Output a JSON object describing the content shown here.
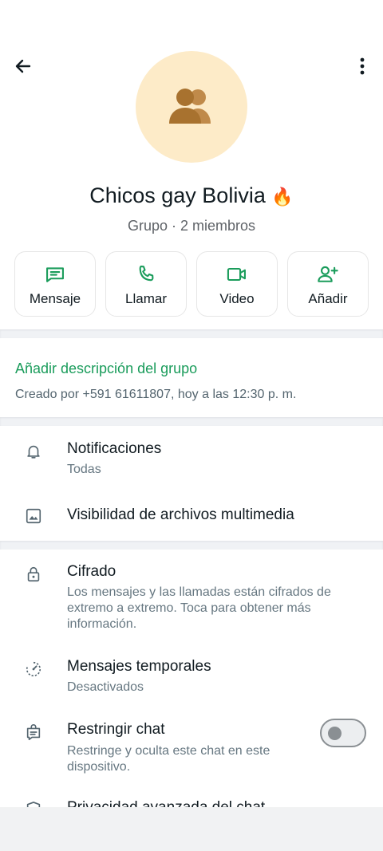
{
  "header": {
    "back_icon": "arrow-left-icon",
    "menu_icon": "more-vertical-icon"
  },
  "group": {
    "avatar_icon": "group-people-icon",
    "name": "Chicos gay Bolivia",
    "emoji": "🔥",
    "meta": "Grupo · 2 miembros"
  },
  "actions": [
    {
      "label": "Mensaje",
      "icon": "message-icon"
    },
    {
      "label": "Llamar",
      "icon": "phone-icon"
    },
    {
      "label": "Video",
      "icon": "video-icon"
    },
    {
      "label": "Añadir",
      "icon": "add-person-icon"
    }
  ],
  "description": {
    "add_link": "Añadir descripción del grupo",
    "created": "Creado por +591 61611807, hoy a las 12:30 p. m."
  },
  "settings": {
    "notifications": {
      "title": "Notificaciones",
      "subtitle": "Todas",
      "icon": "bell-icon"
    },
    "media": {
      "title": "Visibilidad de archivos multimedia",
      "icon": "image-icon"
    }
  },
  "privacy": {
    "encryption": {
      "title": "Cifrado",
      "subtitle": "Los mensajes y las llamadas están cifrados de extremo a extremo. Toca para obtener más información.",
      "icon": "lock-icon"
    },
    "disappearing": {
      "title": "Mensajes temporales",
      "subtitle": "Desactivados",
      "icon": "timer-icon"
    },
    "restrict": {
      "title": "Restringir chat",
      "subtitle": "Restringe y oculta este chat en este dispositivo.",
      "icon": "chat-lock-icon",
      "enabled": false
    },
    "advanced": {
      "title": "Privacidad avanzada del chat",
      "icon": "shield-icon"
    }
  },
  "colors": {
    "accent": "#1a9c5b",
    "avatar_bg": "#fdebc8",
    "avatar_fg": "#a8722f"
  }
}
